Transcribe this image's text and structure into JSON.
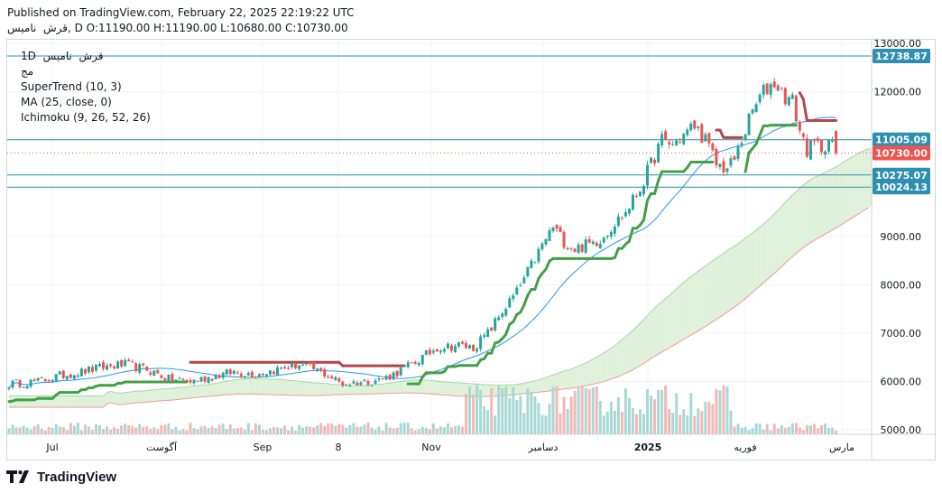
{
  "header": {
    "published": "Published on TradingView.com, February 22, 2025 22:19:22 UTC",
    "ohlc_line": "قرش  ناميس, D O:11190.00 H:11190.00 L:10680.00 C:10730.00"
  },
  "legend": {
    "symbol": "1D  قرش  ناميس",
    "exchange": "مج",
    "supertrend": "SuperTrend (10, 3)",
    "ma": "MA (25, close, 0)",
    "ichimoku": "Ichimoku (9, 26, 52, 26)"
  },
  "branding": {
    "logo_text": "TradingView"
  },
  "chart_data": {
    "type": "candlestick",
    "colors": {
      "up": "#26a69a",
      "down": "#ef5350",
      "supertrend_up": "#43a047",
      "supertrend_down": "#b04949",
      "ma": "#2196f3",
      "hline": "#2e8fb0",
      "last_price": "#ef5350",
      "cloud_bull": "#dff1da",
      "cloud_bear": "#fadede"
    },
    "y_axis": {
      "min": 4900,
      "max": 13000,
      "scale": "linear",
      "ticks": [
        "13000.00",
        "12000.00",
        "11000.00",
        "10000.00",
        "9000.00",
        "8000.00",
        "7000.00",
        "6000.00",
        "5000.00"
      ]
    },
    "x_axis": {
      "ticks": [
        "Jul",
        "آگوست",
        "Sep",
        "8",
        "Nov",
        "دسامبر",
        "2025",
        "فوریه",
        "مارس"
      ],
      "bold_ticks": [
        "2025"
      ]
    },
    "price_labels": [
      {
        "value": 12738.87,
        "text": "12738.87",
        "kind": "hline"
      },
      {
        "value": 11005.09,
        "text": "11005.09",
        "kind": "hline"
      },
      {
        "value": 10730.0,
        "text": "10730.00",
        "kind": "last"
      },
      {
        "value": 10275.07,
        "text": "10275.07",
        "kind": "hline"
      },
      {
        "value": 10024.13,
        "text": "10024.13",
        "kind": "hline"
      }
    ],
    "anchors": [
      [
        0,
        5950
      ],
      [
        8,
        6000
      ],
      [
        14,
        6120
      ],
      [
        20,
        6200
      ],
      [
        26,
        6300
      ],
      [
        32,
        6350
      ],
      [
        38,
        6250
      ],
      [
        44,
        6050
      ],
      [
        50,
        6000
      ],
      [
        56,
        6100
      ],
      [
        62,
        6200
      ],
      [
        68,
        6150
      ],
      [
        74,
        6250
      ],
      [
        80,
        6350
      ],
      [
        86,
        6200
      ],
      [
        92,
        5950
      ],
      [
        98,
        6000
      ],
      [
        103,
        6050
      ],
      [
        106,
        6150
      ],
      [
        112,
        6400
      ],
      [
        118,
        6700
      ],
      [
        124,
        6750
      ],
      [
        128,
        6700
      ],
      [
        132,
        7000
      ],
      [
        136,
        7450
      ],
      [
        140,
        7850
      ],
      [
        144,
        8400
      ],
      [
        148,
        8950
      ],
      [
        150,
        9200
      ],
      [
        153,
        8900
      ],
      [
        156,
        8750
      ],
      [
        160,
        8850
      ],
      [
        163,
        8950
      ],
      [
        166,
        9200
      ],
      [
        170,
        9500
      ],
      [
        174,
        10000
      ],
      [
        177,
        10500
      ],
      [
        180,
        11000
      ],
      [
        183,
        10900
      ],
      [
        186,
        11100
      ],
      [
        189,
        11300
      ],
      [
        192,
        11000
      ],
      [
        195,
        10500
      ],
      [
        198,
        10400
      ],
      [
        200,
        10600
      ],
      [
        202,
        11000
      ],
      [
        205,
        11600
      ],
      [
        208,
        12000
      ],
      [
        211,
        12200
      ],
      [
        214,
        11900
      ],
      [
        216,
        11800
      ],
      [
        218,
        11200
      ],
      [
        220,
        10800
      ],
      [
        222,
        10900
      ],
      [
        224,
        10850
      ],
      [
        226,
        11000
      ],
      [
        228,
        10730
      ]
    ],
    "total_bars": 238,
    "last_bar_index": 228,
    "bar_seed": 12345
  }
}
